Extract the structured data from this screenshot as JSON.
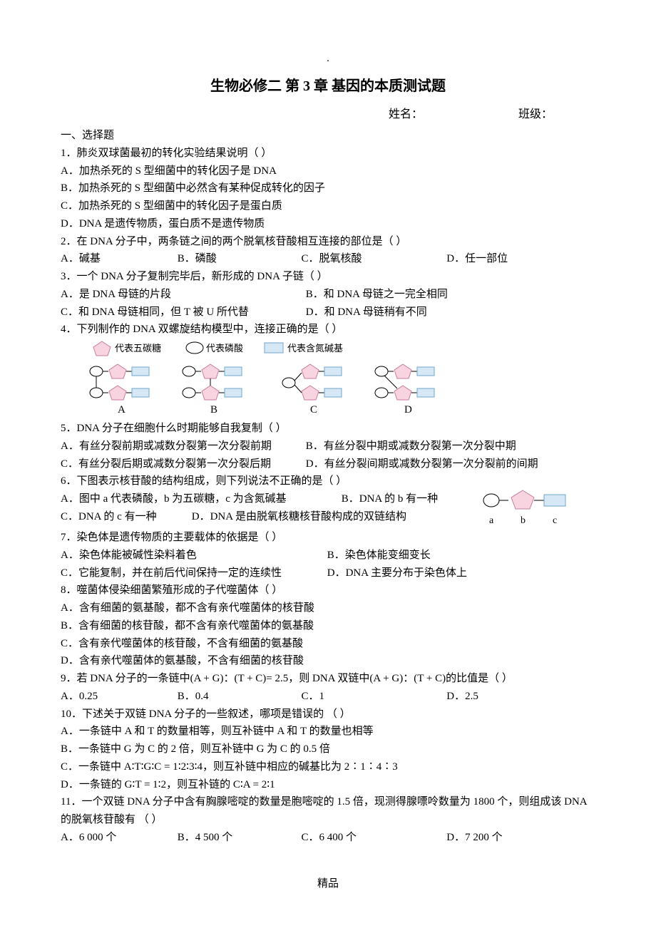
{
  "header": {
    "dot": ".",
    "title": "生物必修二  第 3 章      基因的本质测试题",
    "name_label": "姓名：",
    "class_label": "班级："
  },
  "section1_title": "一、选择题",
  "q1": {
    "stem": "1．肺炎双球菌最初的转化实验结果说明（        ）",
    "A": "A．加热杀死的 S 型细菌中的转化因子是 DNA",
    "B": "B．加热杀死的 S 型细菌中必然含有某种促成转化的因子",
    "C": "C．加热杀死的 S 型细菌中的转化因子是蛋白质",
    "D": "D．DNA 是遗传物质，蛋白质不是遗传物质"
  },
  "q2": {
    "stem": "2．在 DNA 分子中，两条链之间的两个脱氧核苷酸相互连接的部位是（        ）",
    "A": "A．碱基",
    "B": "B．磷酸",
    "C": "C．脱氧核酸",
    "D": "D．任一部位"
  },
  "q3": {
    "stem": "3．一个 DNA 分子复制完毕后，新形成的 DNA 子链（        ）",
    "A": "A．是 DNA 母链的片段",
    "B": "B．和 DNA 母链之一完全相同",
    "C": "C．和 DNA 母链相同，但 T 被 U 所代替",
    "D": "D．和 DNA 母链稍有不同"
  },
  "q4": {
    "stem": "4．下列制作的 DNA 双螺旋结构模型中，连接正确的是（        ）",
    "legend_pentagon": "代表五碳糖",
    "legend_oval": "代表磷酸",
    "legend_rect": "代表含氮碱基",
    "labelA": "A",
    "labelB": "B",
    "labelC": "C",
    "labelD": "D"
  },
  "q5": {
    "stem": "5．DNA 分子在细胞什么时期能够自我复制（        ）",
    "A": "A．有丝分裂前期或减数分裂第一次分裂前期",
    "B": "B．有丝分裂中期或减数分裂第一次分裂中期",
    "C": "C．有丝分裂后期或减数分裂第一次分裂后期",
    "D": "D．有丝分裂间期或减数分裂第一次分裂前的间期"
  },
  "q6": {
    "stem": "6．下图表示核苷酸的结构组成，则下列说法不正确的是（        ）",
    "A": "A．图中 a 代表磷酸，b 为五碳糖，c 为含氮碱基",
    "B": "B．DNA 的 b 有一种",
    "C": "C．DNA 的 c 有一种",
    "D": "D．DNA 是由脱氧核糖核苷酸构成的双链结构",
    "la": "a",
    "lb": "b",
    "lc": "c"
  },
  "q7": {
    "stem": "7．染色体是遗传物质的主要载体的依据是（        ）",
    "A": "A．染色体能被碱性染料着色",
    "B": "B．染色体能变细变长",
    "C": "C．它能复制，并在前后代间保持一定的连续性",
    "D": "D．DNA 主要分布于染色体上"
  },
  "q8": {
    "stem": "8．噬菌体侵染细菌繁殖形成的子代噬菌体（        ）",
    "A": "A．含有细菌的氨基酸，都不含有亲代噬菌体的核苷酸",
    "B": "B．含有细菌的核苷酸，都不含有亲代噬菌体的氨基酸",
    "C": "C．含有亲代噬菌体的核苷酸，不含有细菌的氨基酸",
    "D": "D．含有亲代噬菌体的氨基酸，不含有细菌的核苷酸"
  },
  "q9": {
    "stem": "9．若 DNA 分子的一条链中(A + G)：(T + C)= 2.5，则 DNA 双链中(A + G)：(T + C)的比值是（        ）",
    "A": "A．0.25",
    "B": "B．0.4",
    "C": "C．1",
    "D": "D．2.5"
  },
  "q10": {
    "stem": "10．下述关于双链 DNA 分子的一些叙述，哪项是错误的  （        ）",
    "A": "A．一条链中 A 和 T 的数量相等，则互补链中 A 和 T 的数量也相等",
    "B": "B．一条链中 G 为 C 的 2 倍，则互补链中 G 为 C 的 0.5 倍",
    "C": "C．一条链中 A∶T∶G∶C = 1∶2∶3∶4，则互补链中相应的碱基比为 2∶1∶4∶3",
    "D": "D．一条链的 G∶T = 1∶2，则互补链的 C∶A = 2∶1"
  },
  "q11": {
    "stem": "11．一个双链 DNA 分子中含有胸腺嘧啶的数量是胞嘧啶的 1.5 倍，现测得腺嘌呤数量为 1800 个，则组成该 DNA 的脱氧核苷酸有  （        ）",
    "A": "A．6 000 个",
    "B": "B．4 500 个",
    "C": "C．6 400 个",
    "D": "D．7 200 个"
  },
  "footer": "精品"
}
